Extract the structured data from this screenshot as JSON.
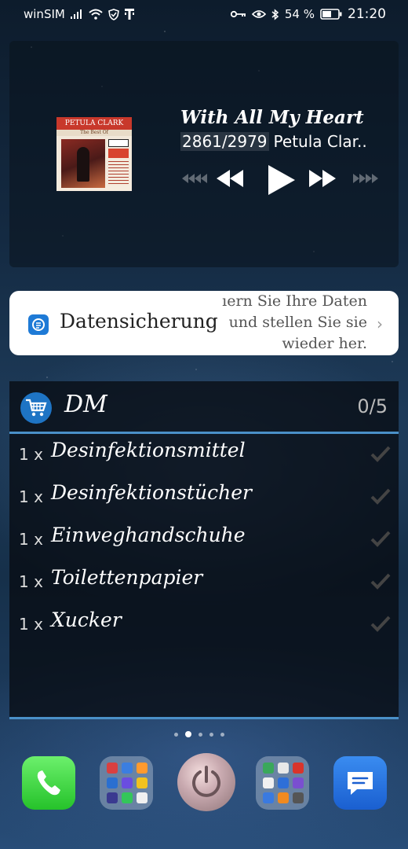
{
  "status_bar": {
    "carrier": "winSIM",
    "battery_percent": "54 %",
    "time": "21:20"
  },
  "music_widget": {
    "album_artist": "PETULA CLARK",
    "album_subtitle": "The Best Of",
    "song_title": "With All My Heart",
    "track_position": "2861/2979",
    "artist": "Petula Clar..",
    "controls": [
      "previous-track",
      "rewind",
      "play",
      "fast-forward",
      "next-track"
    ]
  },
  "backup_banner": {
    "title": "Datensicherung",
    "description_lines": [
      "ıern Sie Ihre Daten",
      "und stellen Sie sie",
      "wieder her."
    ]
  },
  "shopping_list": {
    "title": "DM",
    "count": "0/5",
    "items": [
      {
        "qty": "1 x",
        "name": "Desinfektionsmittel"
      },
      {
        "qty": "1 x",
        "name": "Desinfektionstücher"
      },
      {
        "qty": "1 x",
        "name": "Einweghandschuhe"
      },
      {
        "qty": "1 x",
        "name": "Toilettenpapier"
      },
      {
        "qty": "1 x",
        "name": "Xucker"
      }
    ]
  },
  "page_indicator": {
    "pages": 5,
    "active_index": 1
  },
  "dock": [
    "phone-app",
    "app-folder-1",
    "power-app",
    "app-folder-2",
    "messages-app"
  ],
  "colors": {
    "accent": "#4a90c8",
    "cart_blue": "#1e74c4",
    "phone_green": "#25c22a",
    "messages_blue": "#1a5fd0"
  }
}
